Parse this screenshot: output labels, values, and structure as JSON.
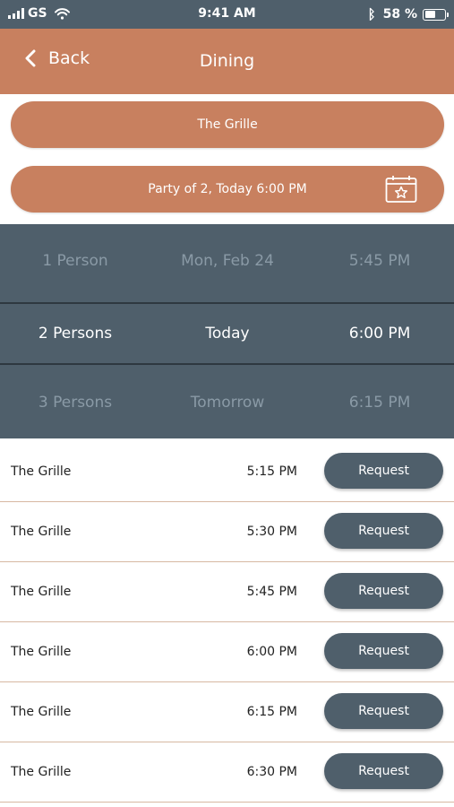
{
  "status_bar": {
    "carrier": "GS",
    "time": "9:41 AM",
    "battery": "58 %",
    "battery_level": 0.58
  },
  "header": {
    "back_label": "Back",
    "title": "Dining"
  },
  "restaurant_selector": {
    "label": "The Grille"
  },
  "party_selector": {
    "label": "Party of 2, Today 6:00 PM",
    "icon": "calendar-star-icon"
  },
  "picker": {
    "rows": [
      {
        "party": "1 Person",
        "day": "Mon, Feb 24",
        "time": "5:45 PM",
        "selected": false
      },
      {
        "party": "2 Persons",
        "day": "Today",
        "time": "6:00 PM",
        "selected": true
      },
      {
        "party": "3 Persons",
        "day": "Tomorrow",
        "time": "6:15 PM",
        "selected": false
      }
    ]
  },
  "slots": [
    {
      "name": "The Grille",
      "time": "5:15 PM",
      "action": "Request"
    },
    {
      "name": "The Grille",
      "time": "5:30 PM",
      "action": "Request"
    },
    {
      "name": "The Grille",
      "time": "5:45 PM",
      "action": "Request"
    },
    {
      "name": "The Grille",
      "time": "6:00 PM",
      "action": "Request"
    },
    {
      "name": "The Grille",
      "time": "6:15 PM",
      "action": "Request"
    },
    {
      "name": "The Grille",
      "time": "6:30 PM",
      "action": "Request"
    }
  ],
  "colors": {
    "accent": "#c8805f",
    "slate": "#4f5f6b",
    "divider": "#d7b8a2"
  }
}
